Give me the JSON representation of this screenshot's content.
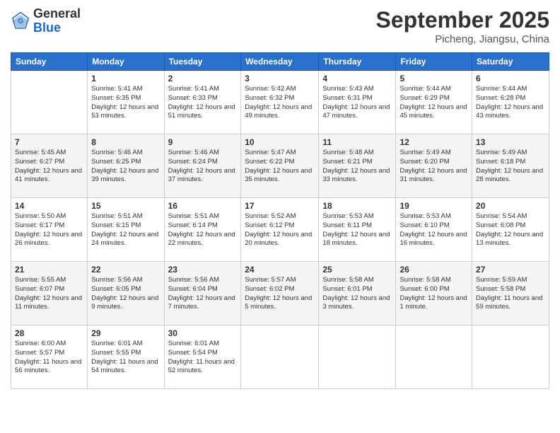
{
  "header": {
    "logo": {
      "general": "General",
      "blue": "Blue"
    },
    "title": "September 2025",
    "location": "Picheng, Jiangsu, China"
  },
  "days_of_week": [
    "Sunday",
    "Monday",
    "Tuesday",
    "Wednesday",
    "Thursday",
    "Friday",
    "Saturday"
  ],
  "weeks": [
    [
      {
        "day": "",
        "sunrise": "",
        "sunset": "",
        "daylight": ""
      },
      {
        "day": "1",
        "sunrise": "Sunrise: 5:41 AM",
        "sunset": "Sunset: 6:35 PM",
        "daylight": "Daylight: 12 hours and 53 minutes."
      },
      {
        "day": "2",
        "sunrise": "Sunrise: 5:41 AM",
        "sunset": "Sunset: 6:33 PM",
        "daylight": "Daylight: 12 hours and 51 minutes."
      },
      {
        "day": "3",
        "sunrise": "Sunrise: 5:42 AM",
        "sunset": "Sunset: 6:32 PM",
        "daylight": "Daylight: 12 hours and 49 minutes."
      },
      {
        "day": "4",
        "sunrise": "Sunrise: 5:43 AM",
        "sunset": "Sunset: 6:31 PM",
        "daylight": "Daylight: 12 hours and 47 minutes."
      },
      {
        "day": "5",
        "sunrise": "Sunrise: 5:44 AM",
        "sunset": "Sunset: 6:29 PM",
        "daylight": "Daylight: 12 hours and 45 minutes."
      },
      {
        "day": "6",
        "sunrise": "Sunrise: 5:44 AM",
        "sunset": "Sunset: 6:28 PM",
        "daylight": "Daylight: 12 hours and 43 minutes."
      }
    ],
    [
      {
        "day": "7",
        "sunrise": "Sunrise: 5:45 AM",
        "sunset": "Sunset: 6:27 PM",
        "daylight": "Daylight: 12 hours and 41 minutes."
      },
      {
        "day": "8",
        "sunrise": "Sunrise: 5:46 AM",
        "sunset": "Sunset: 6:25 PM",
        "daylight": "Daylight: 12 hours and 39 minutes."
      },
      {
        "day": "9",
        "sunrise": "Sunrise: 5:46 AM",
        "sunset": "Sunset: 6:24 PM",
        "daylight": "Daylight: 12 hours and 37 minutes."
      },
      {
        "day": "10",
        "sunrise": "Sunrise: 5:47 AM",
        "sunset": "Sunset: 6:22 PM",
        "daylight": "Daylight: 12 hours and 35 minutes."
      },
      {
        "day": "11",
        "sunrise": "Sunrise: 5:48 AM",
        "sunset": "Sunset: 6:21 PM",
        "daylight": "Daylight: 12 hours and 33 minutes."
      },
      {
        "day": "12",
        "sunrise": "Sunrise: 5:49 AM",
        "sunset": "Sunset: 6:20 PM",
        "daylight": "Daylight: 12 hours and 31 minutes."
      },
      {
        "day": "13",
        "sunrise": "Sunrise: 5:49 AM",
        "sunset": "Sunset: 6:18 PM",
        "daylight": "Daylight: 12 hours and 28 minutes."
      }
    ],
    [
      {
        "day": "14",
        "sunrise": "Sunrise: 5:50 AM",
        "sunset": "Sunset: 6:17 PM",
        "daylight": "Daylight: 12 hours and 26 minutes."
      },
      {
        "day": "15",
        "sunrise": "Sunrise: 5:51 AM",
        "sunset": "Sunset: 6:15 PM",
        "daylight": "Daylight: 12 hours and 24 minutes."
      },
      {
        "day": "16",
        "sunrise": "Sunrise: 5:51 AM",
        "sunset": "Sunset: 6:14 PM",
        "daylight": "Daylight: 12 hours and 22 minutes."
      },
      {
        "day": "17",
        "sunrise": "Sunrise: 5:52 AM",
        "sunset": "Sunset: 6:12 PM",
        "daylight": "Daylight: 12 hours and 20 minutes."
      },
      {
        "day": "18",
        "sunrise": "Sunrise: 5:53 AM",
        "sunset": "Sunset: 6:11 PM",
        "daylight": "Daylight: 12 hours and 18 minutes."
      },
      {
        "day": "19",
        "sunrise": "Sunrise: 5:53 AM",
        "sunset": "Sunset: 6:10 PM",
        "daylight": "Daylight: 12 hours and 16 minutes."
      },
      {
        "day": "20",
        "sunrise": "Sunrise: 5:54 AM",
        "sunset": "Sunset: 6:08 PM",
        "daylight": "Daylight: 12 hours and 13 minutes."
      }
    ],
    [
      {
        "day": "21",
        "sunrise": "Sunrise: 5:55 AM",
        "sunset": "Sunset: 6:07 PM",
        "daylight": "Daylight: 12 hours and 11 minutes."
      },
      {
        "day": "22",
        "sunrise": "Sunrise: 5:56 AM",
        "sunset": "Sunset: 6:05 PM",
        "daylight": "Daylight: 12 hours and 9 minutes."
      },
      {
        "day": "23",
        "sunrise": "Sunrise: 5:56 AM",
        "sunset": "Sunset: 6:04 PM",
        "daylight": "Daylight: 12 hours and 7 minutes."
      },
      {
        "day": "24",
        "sunrise": "Sunrise: 5:57 AM",
        "sunset": "Sunset: 6:02 PM",
        "daylight": "Daylight: 12 hours and 5 minutes."
      },
      {
        "day": "25",
        "sunrise": "Sunrise: 5:58 AM",
        "sunset": "Sunset: 6:01 PM",
        "daylight": "Daylight: 12 hours and 3 minutes."
      },
      {
        "day": "26",
        "sunrise": "Sunrise: 5:58 AM",
        "sunset": "Sunset: 6:00 PM",
        "daylight": "Daylight: 12 hours and 1 minute."
      },
      {
        "day": "27",
        "sunrise": "Sunrise: 5:59 AM",
        "sunset": "Sunset: 5:58 PM",
        "daylight": "Daylight: 11 hours and 59 minutes."
      }
    ],
    [
      {
        "day": "28",
        "sunrise": "Sunrise: 6:00 AM",
        "sunset": "Sunset: 5:57 PM",
        "daylight": "Daylight: 11 hours and 56 minutes."
      },
      {
        "day": "29",
        "sunrise": "Sunrise: 6:01 AM",
        "sunset": "Sunset: 5:55 PM",
        "daylight": "Daylight: 11 hours and 54 minutes."
      },
      {
        "day": "30",
        "sunrise": "Sunrise: 6:01 AM",
        "sunset": "Sunset: 5:54 PM",
        "daylight": "Daylight: 11 hours and 52 minutes."
      },
      {
        "day": "",
        "sunrise": "",
        "sunset": "",
        "daylight": ""
      },
      {
        "day": "",
        "sunrise": "",
        "sunset": "",
        "daylight": ""
      },
      {
        "day": "",
        "sunrise": "",
        "sunset": "",
        "daylight": ""
      },
      {
        "day": "",
        "sunrise": "",
        "sunset": "",
        "daylight": ""
      }
    ]
  ]
}
